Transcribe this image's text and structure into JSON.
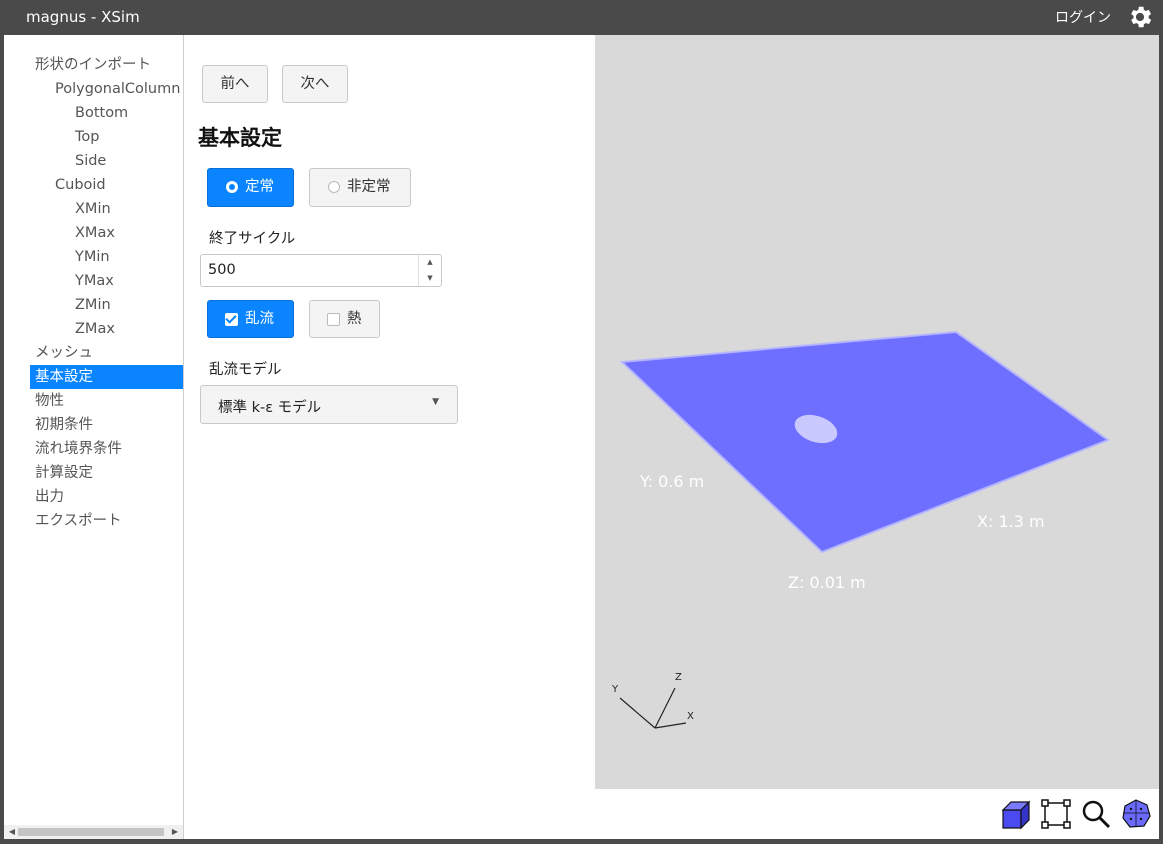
{
  "app": {
    "title": "magnus - XSim",
    "login": "ログイン"
  },
  "sidebar": {
    "items": [
      {
        "label": "形状のインポート",
        "level": 0
      },
      {
        "label": "PolygonalColumn",
        "level": 1
      },
      {
        "label": "Bottom",
        "level": 2
      },
      {
        "label": "Top",
        "level": 2
      },
      {
        "label": "Side",
        "level": 2
      },
      {
        "label": "Cuboid",
        "level": 1
      },
      {
        "label": "XMin",
        "level": 2
      },
      {
        "label": "XMax",
        "level": 2
      },
      {
        "label": "YMin",
        "level": 2
      },
      {
        "label": "YMax",
        "level": 2
      },
      {
        "label": "ZMin",
        "level": 2
      },
      {
        "label": "ZMax",
        "level": 2
      },
      {
        "label": "メッシュ",
        "level": 0
      },
      {
        "label": "基本設定",
        "level": 0,
        "active": true
      },
      {
        "label": "物性",
        "level": 0
      },
      {
        "label": "初期条件",
        "level": 0
      },
      {
        "label": "流れ境界条件",
        "level": 0
      },
      {
        "label": "計算設定",
        "level": 0
      },
      {
        "label": "出力",
        "level": 0
      },
      {
        "label": "エクスポート",
        "level": 0
      }
    ]
  },
  "panel": {
    "prev": "前へ",
    "next": "次へ",
    "title": "基本設定",
    "steady": "定常",
    "unsteady": "非定常",
    "cycles_label": "終了サイクル",
    "cycles_value": "500",
    "turbulence": "乱流",
    "heat": "熱",
    "turb_model_label": "乱流モデル",
    "turb_model_value": "標準 k-ε モデル"
  },
  "viewport": {
    "dims": {
      "y": "Y: 0.6 m",
      "x": "X: 1.3 m",
      "z": "Z: 0.01 m"
    },
    "axes": {
      "x": "X",
      "y": "Y",
      "z": "Z"
    },
    "colors": {
      "plane": "#6a6aff",
      "background": "#d9d9d9",
      "accent": "#0a85ff"
    }
  },
  "toolbar": [
    "cube-icon",
    "fit-view-icon",
    "zoom-icon",
    "mesh-sphere-icon"
  ]
}
